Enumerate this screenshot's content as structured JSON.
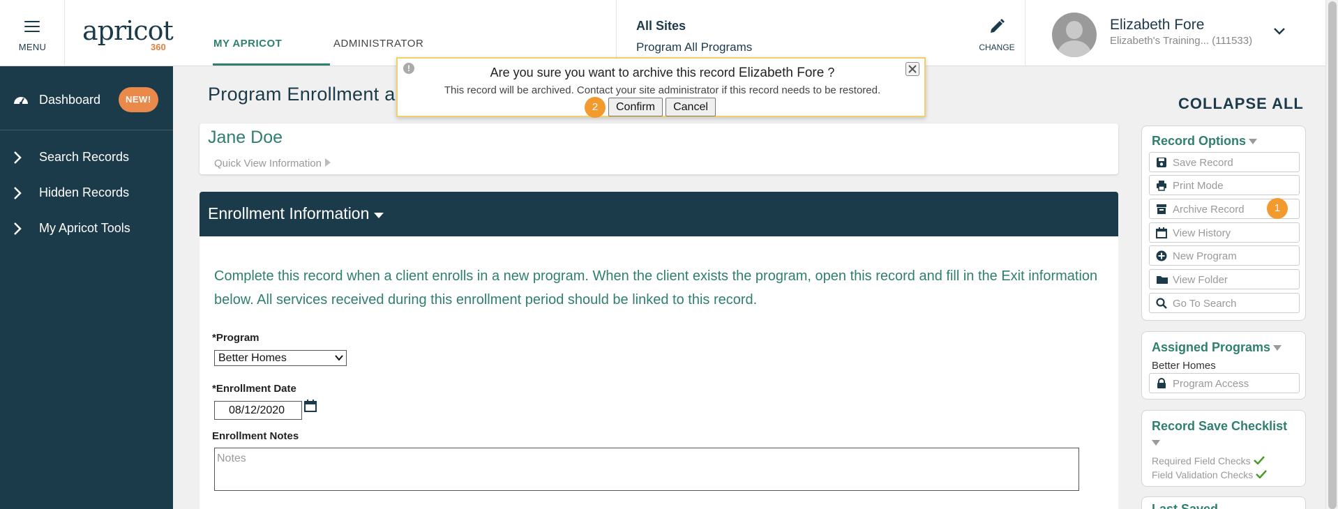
{
  "header": {
    "menu_label": "MENU",
    "logo_text": "apricot",
    "logo_number": "360",
    "tabs": [
      {
        "label": "MY APRICOT",
        "active": true
      },
      {
        "label": "ADMINISTRATOR",
        "active": false
      }
    ],
    "site": "All Sites",
    "program": "Program All Programs",
    "change_label": "CHANGE",
    "user_name": "Elizabeth Fore",
    "user_sub": "Elizabeth's Training...  (111533)"
  },
  "sidebar": {
    "items": [
      {
        "label": "Dashboard",
        "badge": "NEW!",
        "icon": "dashboard-icon"
      },
      {
        "label": "Search Records",
        "icon": "chevron-right-icon"
      },
      {
        "label": "Hidden Records",
        "icon": "chevron-right-icon"
      },
      {
        "label": "My Apricot Tools",
        "icon": "chevron-right-icon"
      }
    ]
  },
  "main": {
    "page_title": "Program Enrollment a",
    "record_name": "Jane Doe",
    "quick_view": "Quick View Information",
    "section_title": "Enrollment Information",
    "description": "Complete this record when a client enrolls in a new program. When the client exists the program, open this record and fill in the Exit information below. All services received during this enrollment period should be linked to this record.",
    "program_label": "*Program",
    "program_value": "Better Homes",
    "enrollment_date_label": "*Enrollment Date",
    "enrollment_date_value": "08/12/2020",
    "notes_label": "Enrollment Notes",
    "notes_placeholder": "Notes"
  },
  "right": {
    "collapse_all": "COLLAPSE ALL",
    "record_options_title": "Record Options",
    "record_options": [
      {
        "label": "Save Record",
        "icon": "save-icon"
      },
      {
        "label": "Print Mode",
        "icon": "print-icon"
      },
      {
        "label": "Archive Record",
        "icon": "archive-icon"
      },
      {
        "label": "View History",
        "icon": "calendar-icon"
      },
      {
        "label": "New Program",
        "icon": "plus-circle-icon"
      },
      {
        "label": "View Folder",
        "icon": "folder-icon"
      },
      {
        "label": "Go To Search",
        "icon": "search-icon"
      }
    ],
    "assigned_title": "Assigned Programs",
    "assigned_program": "Better Homes",
    "program_access": "Program Access",
    "checklist_title": "Record Save Checklist",
    "checklist": [
      "Required Field Checks",
      "Field Validation Checks"
    ],
    "last_saved_partial": "Last Saved"
  },
  "dialog": {
    "question": "Are you sure you want to archive this record",
    "record_name": "Elizabeth Fore",
    "question_mark": "?",
    "info": "This record will be archived. Contact your site administrator if this record needs to be restored.",
    "confirm": "Confirm",
    "cancel": "Cancel"
  },
  "step_badges": {
    "archive": "1",
    "confirm": "2"
  },
  "colors": {
    "navy": "#1b3a4a",
    "teal": "#2f7f6f",
    "orange": "#e98a4b",
    "step": "#f39a2e"
  }
}
